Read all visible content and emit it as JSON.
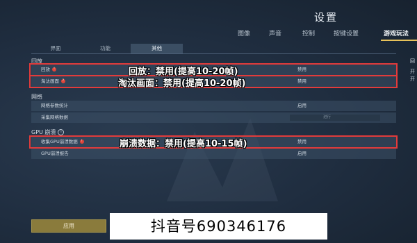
{
  "window": {
    "title": "设置"
  },
  "top_nav": {
    "tabs": [
      {
        "label": "图像"
      },
      {
        "label": "声音"
      },
      {
        "label": "控制"
      },
      {
        "label": "按键设置"
      },
      {
        "label": "游戏玩法"
      }
    ],
    "active": "游戏玩法"
  },
  "sub_tabs": {
    "tabs": [
      {
        "label": "界面"
      },
      {
        "label": "功能"
      },
      {
        "label": "其他"
      }
    ],
    "active": "其他"
  },
  "sections": {
    "replay": {
      "title": "回放",
      "rows": [
        {
          "label": "回放",
          "badge": "!",
          "value": "禁用"
        },
        {
          "label": "淘汰画面",
          "badge": "?",
          "value": "禁用"
        }
      ]
    },
    "network": {
      "title": "网络",
      "rows": [
        {
          "label": "网络参数统计",
          "value": "启用"
        },
        {
          "label": "采集网络数据",
          "value": "进行"
        }
      ]
    },
    "gpu_crash": {
      "title": "GPU 崩溃",
      "info_icon": "i",
      "rows": [
        {
          "label": "收集GPU崩溃数据",
          "badge": "!",
          "value": "禁用"
        },
        {
          "label": "GPU崩溃报告",
          "value": "启用"
        }
      ]
    }
  },
  "annotations": {
    "replay": "回放：禁用(提高10-20帧)",
    "elimination": "淘汰画面：禁用(提高10-20帧)",
    "gpu_crash": "崩溃数据：禁用(提高10-15帧)"
  },
  "right_panel": {
    "title": "回",
    "items": [
      "开",
      "开"
    ]
  },
  "footer": {
    "apply_label": "应用"
  },
  "watermark": "抖音号690346176",
  "colors": {
    "background": "#1f2d3f",
    "highlight_border": "#e23b3b",
    "active_tab_underline": "#e8c25a",
    "apply_button": "#8a7b3c",
    "badge": "#e0453a"
  }
}
